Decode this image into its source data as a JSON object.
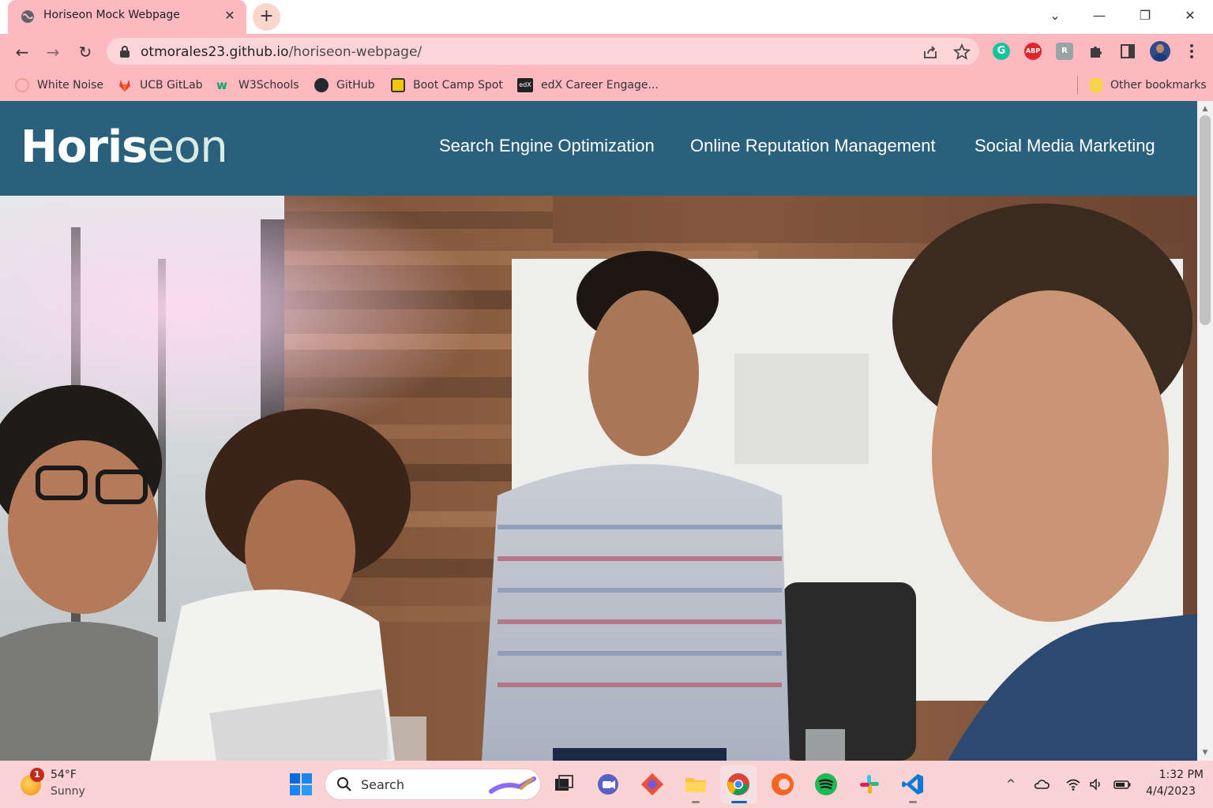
{
  "browser": {
    "tab": {
      "title": "Horiseon Mock Webpage",
      "close_glyph": "✕"
    },
    "new_tab_glyph": "+",
    "window_controls": {
      "tab_search": "⌄",
      "minimize": "—",
      "restore": "❐",
      "close": "✕"
    },
    "nav": {
      "back": "←",
      "forward": "→",
      "reload": "↻"
    },
    "address": {
      "host": "otmorales23.github.io",
      "path": "/horiseon-webpage/"
    },
    "bookmarks": [
      {
        "label": "White Noise",
        "icon": "white-noise-icon",
        "color": "#f0a08a"
      },
      {
        "label": "UCB GitLab",
        "icon": "gitlab-icon",
        "color": "#e24329"
      },
      {
        "label": "W3Schools",
        "icon": "w3schools-icon",
        "color": "#04aa6d"
      },
      {
        "label": "GitHub",
        "icon": "github-icon",
        "color": "#24292e"
      },
      {
        "label": "Boot Camp Spot",
        "icon": "bootcampspot-icon",
        "color": "#f6c700"
      },
      {
        "label": "edX Career Engage...",
        "icon": "edx-icon",
        "color": "#222222"
      }
    ],
    "other_bookmarks": "Other bookmarks",
    "extensions": [
      {
        "name": "grammarly-icon",
        "text": "G",
        "color": "#15c39a"
      },
      {
        "name": "adblock-plus-icon",
        "text": "ABP",
        "color": "#e0262a"
      },
      {
        "name": "extension-r-icon",
        "text": "R",
        "color": "#9aa4a8"
      }
    ]
  },
  "site": {
    "logo_main": "Horis",
    "logo_tail": "eon",
    "nav": [
      "Search Engine Optimization",
      "Online Reputation Management",
      "Social Media Marketing"
    ],
    "header_color": "#2a607c"
  },
  "taskbar": {
    "weather": {
      "badge": "1",
      "temp": "54°F",
      "condition": "Sunny"
    },
    "search_label": "Search",
    "clock": {
      "time": "1:32 PM",
      "date": "4/4/2023"
    }
  }
}
